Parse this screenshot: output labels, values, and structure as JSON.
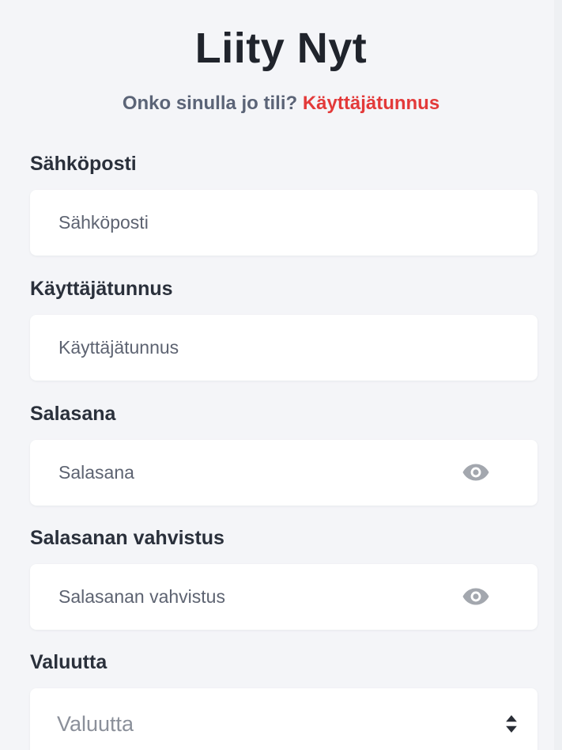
{
  "header": {
    "title": "Liity Nyt",
    "subtitle_text": "Onko sinulla jo tili?",
    "subtitle_link": "Käyttäjätunnus"
  },
  "form": {
    "email": {
      "label": "Sähköposti",
      "placeholder": "Sähköposti"
    },
    "username": {
      "label": "Käyttäjätunnus",
      "placeholder": "Käyttäjätunnus"
    },
    "password": {
      "label": "Salasana",
      "placeholder": "Salasana",
      "icon": "eye-icon"
    },
    "password_confirm": {
      "label": "Salasanan vahvistus",
      "placeholder": "Salasanan vahvistus",
      "icon": "eye-icon"
    },
    "currency": {
      "label": "Valuutta",
      "placeholder": "Valuutta",
      "icon": "up-down-chevron-icon"
    }
  },
  "colors": {
    "background": "#f4f5f8",
    "link": "#e33a3a",
    "muted_text": "#5b6477",
    "field_bg": "#ffffff"
  }
}
